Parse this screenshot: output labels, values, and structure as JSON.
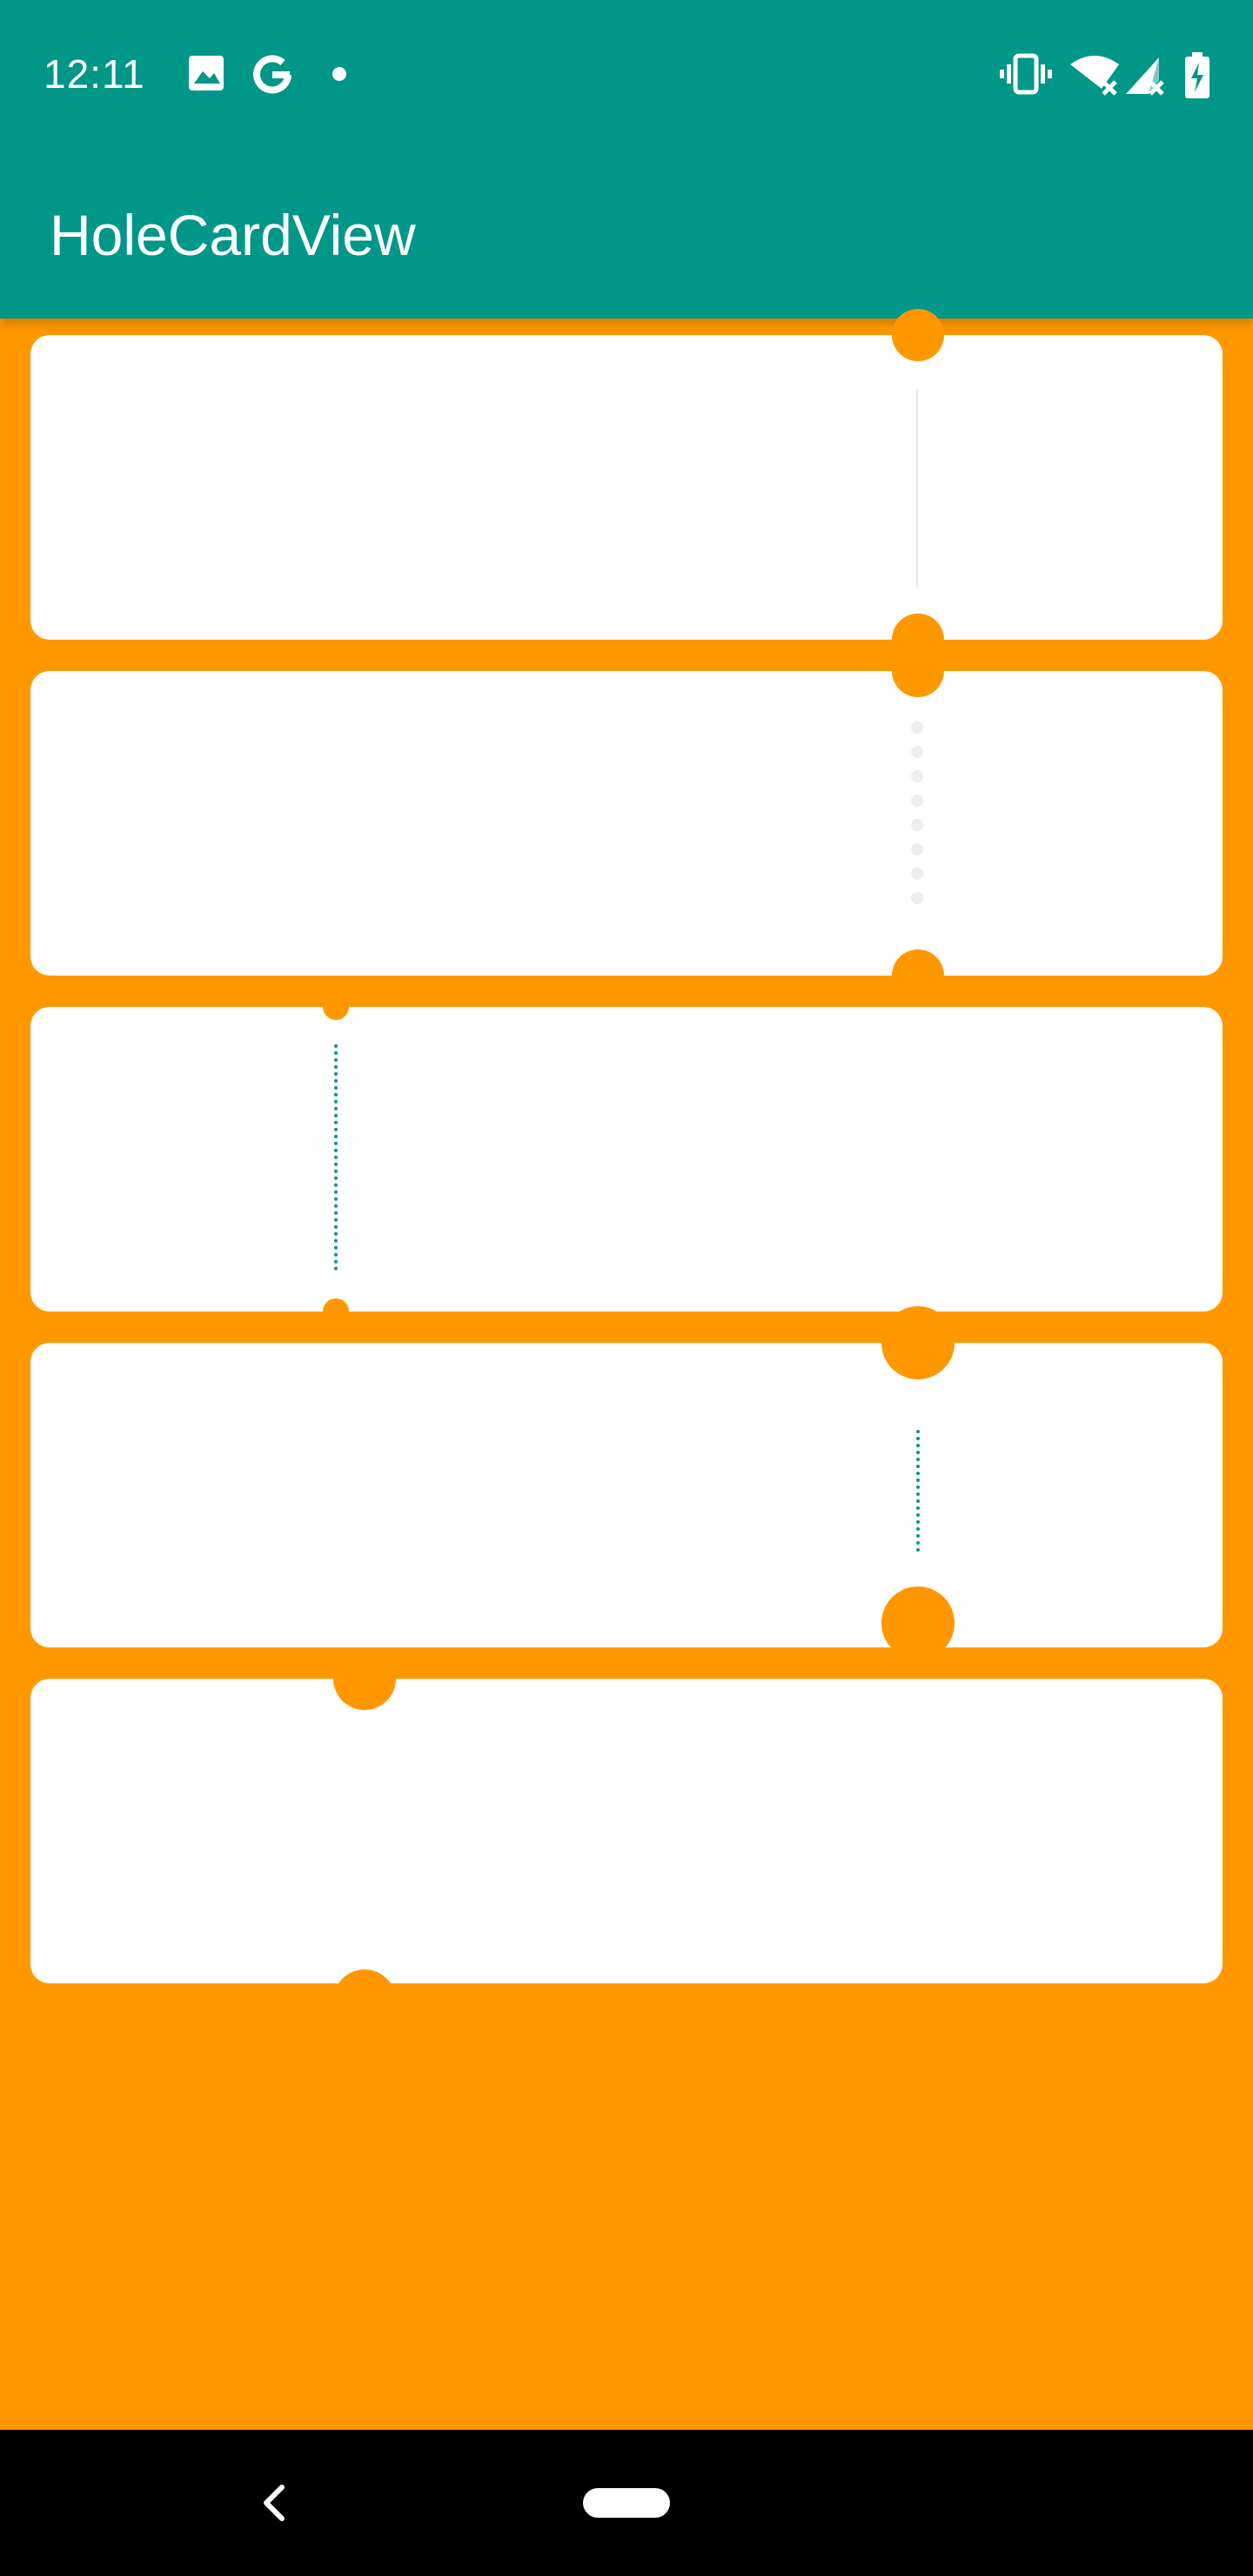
{
  "status_bar": {
    "time": "12:11",
    "left_icons": [
      "image-icon",
      "google-icon",
      "notification-dot-icon"
    ],
    "right_icons": [
      "vibrate-icon",
      "wifi-off-icon",
      "signal-off-icon",
      "battery-charging-icon"
    ],
    "background": "#009688"
  },
  "app_bar": {
    "title": "HoleCardView",
    "background": "#009688"
  },
  "page": {
    "background": "#FF9800",
    "card_color": "#FFFFFF"
  },
  "cards": [
    {
      "name": "card-1",
      "divider": "solid-line",
      "divider_color": "#E6E6E6"
    },
    {
      "name": "card-2",
      "divider": "dots",
      "divider_color": "#EEEEEE"
    },
    {
      "name": "card-3",
      "divider": "dotted-line",
      "divider_color": "#009688"
    },
    {
      "name": "card-4",
      "divider": "dotted-line",
      "divider_color": "#009688"
    },
    {
      "name": "card-5",
      "divider": "none"
    }
  ],
  "nav_bar": {
    "icons": [
      "back-icon",
      "home-pill-icon"
    ],
    "background": "#000000"
  }
}
